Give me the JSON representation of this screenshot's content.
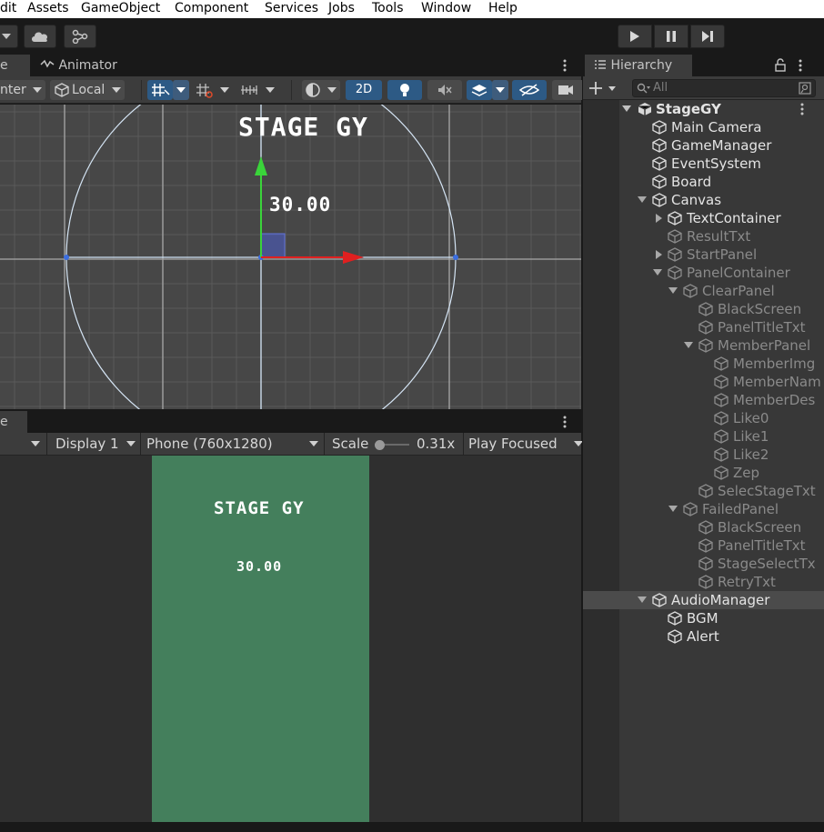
{
  "menu": [
    "dit",
    "Assets",
    "GameObject",
    "Component",
    "Services",
    "Jobs",
    "Tools",
    "Window",
    "Help"
  ],
  "scene_tabs": {
    "scene_partial": "e",
    "animator": "Animator"
  },
  "scene_tools": {
    "pivot": "nter",
    "space": "Local",
    "mode2d": "2D"
  },
  "scene_content": {
    "title": "STAGE GY",
    "timer": "30.00"
  },
  "game_tab_partial": "e",
  "game_tools": {
    "display": "Display 1",
    "resolution": "Phone (760x1280)",
    "scale_label": "Scale",
    "scale_value": "0.31x",
    "play_mode": "Play Focused"
  },
  "game_content": {
    "title": "STAGE GY",
    "timer": "30.00"
  },
  "hierarchy": {
    "title": "Hierarchy",
    "search_placeholder": "All",
    "scene_name": "StageGY",
    "items": [
      {
        "label": "Main Camera",
        "depth": 1,
        "arrow": "",
        "active": true
      },
      {
        "label": "GameManager",
        "depth": 1,
        "arrow": "",
        "active": true
      },
      {
        "label": "EventSystem",
        "depth": 1,
        "arrow": "",
        "active": true
      },
      {
        "label": "Board",
        "depth": 1,
        "arrow": "",
        "active": true
      },
      {
        "label": "Canvas",
        "depth": 1,
        "arrow": "down",
        "active": true
      },
      {
        "label": "TextContainer",
        "depth": 2,
        "arrow": "right",
        "active": true
      },
      {
        "label": "ResultTxt",
        "depth": 2,
        "arrow": "",
        "active": false
      },
      {
        "label": "StartPanel",
        "depth": 2,
        "arrow": "right",
        "active": false
      },
      {
        "label": "PanelContainer",
        "depth": 2,
        "arrow": "down",
        "active": false
      },
      {
        "label": "ClearPanel",
        "depth": 3,
        "arrow": "down",
        "active": false
      },
      {
        "label": "BlackScreen",
        "depth": 4,
        "arrow": "",
        "active": false
      },
      {
        "label": "PanelTitleTxt",
        "depth": 4,
        "arrow": "",
        "active": false
      },
      {
        "label": "MemberPanel",
        "depth": 4,
        "arrow": "down",
        "active": false
      },
      {
        "label": "MemberImg",
        "depth": 5,
        "arrow": "",
        "active": false
      },
      {
        "label": "MemberNam",
        "depth": 5,
        "arrow": "",
        "active": false
      },
      {
        "label": "MemberDes",
        "depth": 5,
        "arrow": "",
        "active": false
      },
      {
        "label": "Like0",
        "depth": 5,
        "arrow": "",
        "active": false
      },
      {
        "label": "Like1",
        "depth": 5,
        "arrow": "",
        "active": false
      },
      {
        "label": "Like2",
        "depth": 5,
        "arrow": "",
        "active": false
      },
      {
        "label": "Zep",
        "depth": 5,
        "arrow": "",
        "active": false
      },
      {
        "label": "SelecStageTxt",
        "depth": 4,
        "arrow": "",
        "active": false
      },
      {
        "label": "FailedPanel",
        "depth": 3,
        "arrow": "down",
        "active": false
      },
      {
        "label": "BlackScreen",
        "depth": 4,
        "arrow": "",
        "active": false
      },
      {
        "label": "PanelTitleTxt",
        "depth": 4,
        "arrow": "",
        "active": false
      },
      {
        "label": "StageSelectTx",
        "depth": 4,
        "arrow": "",
        "active": false
      },
      {
        "label": "RetryTxt",
        "depth": 4,
        "arrow": "",
        "active": false
      },
      {
        "label": "AudioManager",
        "depth": 1,
        "arrow": "down",
        "active": true,
        "selected": true
      },
      {
        "label": "BGM",
        "depth": 2,
        "arrow": "",
        "active": true
      },
      {
        "label": "Alert",
        "depth": 2,
        "arrow": "",
        "active": true
      }
    ]
  },
  "colors": {
    "accent_blue": "#2d5a85",
    "game_bg": "#447f5c",
    "gizmo_green": "#3ad43a",
    "gizmo_red": "#e02020"
  }
}
